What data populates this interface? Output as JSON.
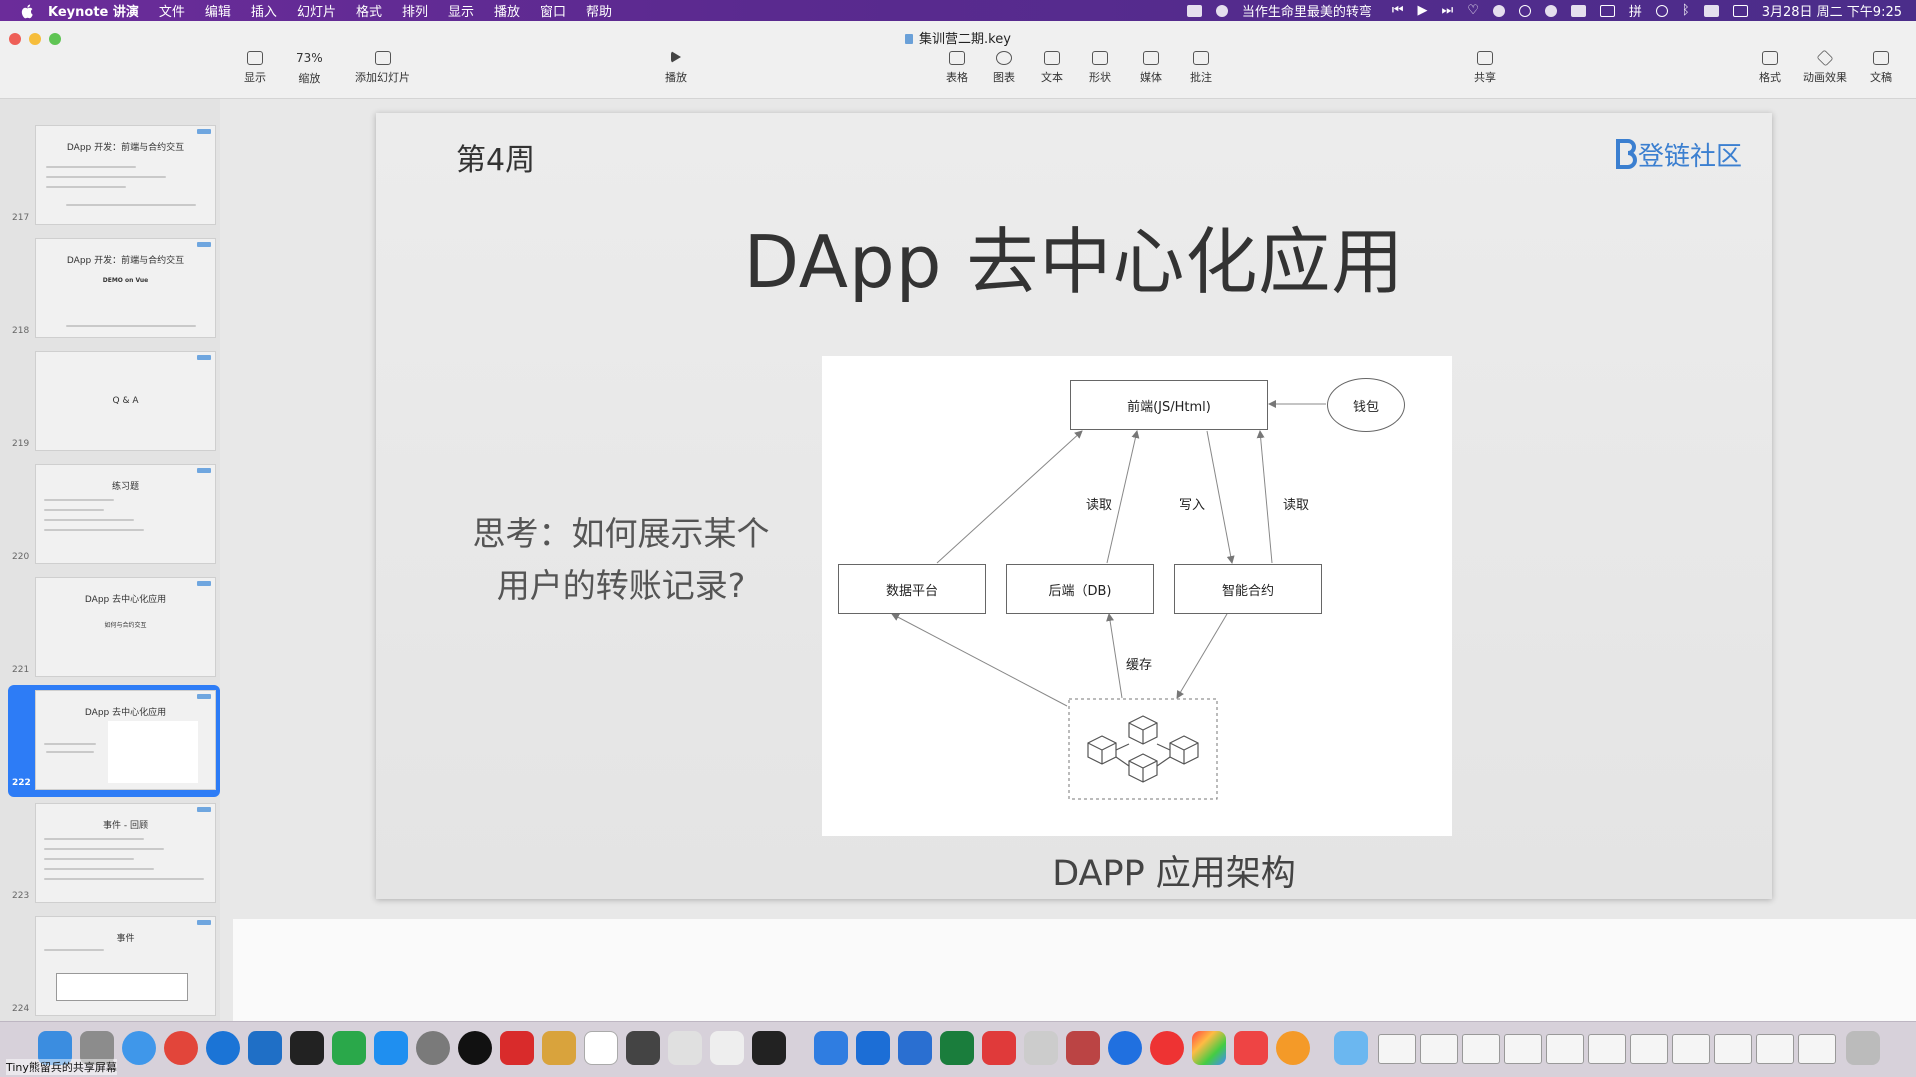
{
  "menubar": {
    "app_name": "Keynote 讲演",
    "items": [
      "文件",
      "编辑",
      "插入",
      "幻灯片",
      "格式",
      "排列",
      "显示",
      "播放",
      "窗口",
      "帮助"
    ],
    "now_playing": "当作生命里最美的转弯",
    "clock": "3月28日 周二 下午9:25",
    "input_method": "拼"
  },
  "window": {
    "title": "集训营二期.key"
  },
  "toolbar": {
    "view_label": "显示",
    "zoom_value": "73%",
    "zoom_label": "缩放",
    "add_slide_label": "添加幻灯片",
    "play_label": "播放",
    "table_label": "表格",
    "chart_label": "图表",
    "text_label": "文本",
    "shape_label": "形状",
    "media_label": "媒体",
    "comment_label": "批注",
    "share_label": "共享",
    "format_label": "格式",
    "animate_label": "动画效果",
    "document_label": "文稿"
  },
  "sidebar": {
    "slides": [
      {
        "num": "217",
        "title": "DApp 开发：前端与合约交互"
      },
      {
        "num": "218",
        "title": "DApp 开发：前端与合约交互",
        "sub": "DEMO on Vue"
      },
      {
        "num": "219",
        "title": "Q & A"
      },
      {
        "num": "220",
        "title": "练习题"
      },
      {
        "num": "221",
        "title": "DApp 去中心化应用",
        "sub": "如何与合约交互"
      },
      {
        "num": "222",
        "title": "DApp 去中心化应用",
        "selected": true
      },
      {
        "num": "223",
        "title": "事件 - 回顾"
      },
      {
        "num": "224",
        "title": "事件"
      }
    ]
  },
  "slide": {
    "week": "第4周",
    "brand": "登链社区",
    "title": "DApp 去中心化应用",
    "question_line1": "思考：如何展示某个",
    "question_line2": "用户的转账记录?",
    "caption": "DAPP 应用架构",
    "diagram": {
      "frontend": "前端(JS/Html)",
      "wallet": "钱包",
      "data_platform": "数据平台",
      "backend": "后端（DB)",
      "contract": "智能合约",
      "read1": "读取",
      "write": "写入",
      "read2": "读取",
      "cache": "缓存"
    }
  },
  "dock": {
    "share_text": "Tiny熊留兵的共享屏幕"
  },
  "colors": {
    "menubar": "#5a2a8f",
    "selection": "#2d7cf6",
    "brand": "#3b7fd0"
  }
}
